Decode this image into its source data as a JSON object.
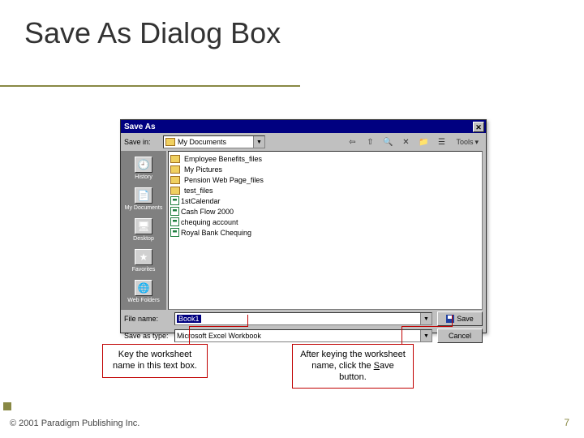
{
  "title": "Save As Dialog Box",
  "dialog": {
    "title": "Save As",
    "close": "✕",
    "savein_label": "Save in:",
    "savein_value": "My Documents",
    "toolbar": {
      "back": "⇦",
      "up": "⇧",
      "search": "🔍",
      "delete": "✕",
      "newfolder": "📁",
      "views": "☰",
      "tools_label": "Tools",
      "tools_arrow": "▾"
    },
    "places": [
      {
        "label": "History",
        "icon": "🕘"
      },
      {
        "label": "My Documents",
        "icon": "📄"
      },
      {
        "label": "Desktop",
        "icon": "🖥"
      },
      {
        "label": "Favorites",
        "icon": "★"
      },
      {
        "label": "Web Folders",
        "icon": "🌐"
      }
    ],
    "files": [
      {
        "type": "folder",
        "name": "Employee Benefits_files"
      },
      {
        "type": "folder",
        "name": "My Pictures"
      },
      {
        "type": "folder",
        "name": "Pension Web Page_files"
      },
      {
        "type": "folder",
        "name": "test_files"
      },
      {
        "type": "xls",
        "name": "1stCalendar"
      },
      {
        "type": "xls",
        "name": "Cash Flow 2000"
      },
      {
        "type": "xls",
        "name": "chequing account"
      },
      {
        "type": "xls",
        "name": "Royal Bank Chequing"
      }
    ],
    "filename_label": "File name:",
    "filename_value": "Book1",
    "saveastype_label": "Save as type:",
    "saveastype_value": "Microsoft Excel Workbook",
    "save_btn": "Save",
    "cancel_btn": "Cancel"
  },
  "callouts": {
    "left": "Key the worksheet name in this text box.",
    "right_prefix": "After keying the worksheet name, click the ",
    "right_underlined": "S",
    "right_rest": "ave button."
  },
  "footer": {
    "copyright": "© 2001 Paradigm Publishing Inc.",
    "page": "7"
  }
}
